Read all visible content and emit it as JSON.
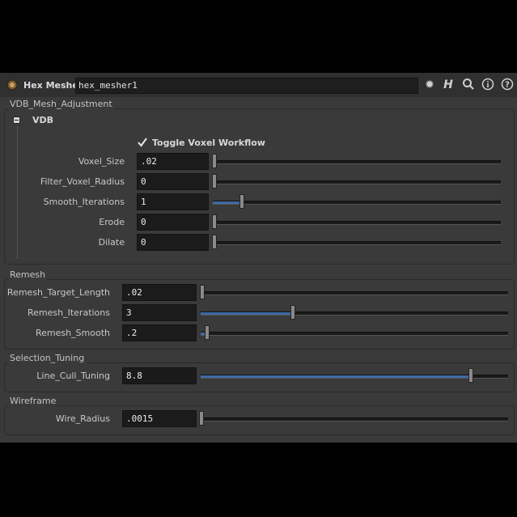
{
  "header": {
    "node_type": "Hex Mesher",
    "node_name": "hex_mesher1"
  },
  "groups": {
    "vdb_mesh_adjustment": {
      "label": "VDB_Mesh_Adjustment",
      "folder": "VDB",
      "toggle_label": "Toggle Voxel Workflow",
      "params": [
        {
          "label": "Voxel_Size",
          "value": ".02",
          "fraction": 0.0
        },
        {
          "label": "Filter_Voxel_Radius",
          "value": "0",
          "fraction": 0.0
        },
        {
          "label": "Smooth_Iterations",
          "value": "1",
          "fraction": 0.1
        },
        {
          "label": "Erode",
          "value": "0",
          "fraction": 0.0
        },
        {
          "label": "Dilate",
          "value": "0",
          "fraction": 0.0
        }
      ]
    },
    "remesh": {
      "label": "Remesh",
      "params": [
        {
          "label": "Remesh_Target_Length",
          "value": ".02",
          "fraction": 0.0
        },
        {
          "label": "Remesh_Iterations",
          "value": "3",
          "fraction": 0.3
        },
        {
          "label": "Remesh_Smooth",
          "value": ".2",
          "fraction": 0.02
        }
      ]
    },
    "selection_tuning": {
      "label": "Selection_Tuning",
      "params": [
        {
          "label": "Line_Cull_Tuning",
          "value": "8.8",
          "fraction": 0.88
        }
      ]
    },
    "wireframe": {
      "label": "Wireframe",
      "params": [
        {
          "label": "Wire_Radius",
          "value": ".0015",
          "fraction": 0.0
        }
      ]
    }
  },
  "colors": {
    "slider_fill": "#3d6ba8",
    "panel_bg": "#3a3a3a"
  },
  "icons": [
    "node-icon",
    "gear-icon",
    "houdini-h-icon",
    "search-icon",
    "info-icon",
    "help-icon",
    "checkmark-icon",
    "collapse-icon"
  ]
}
